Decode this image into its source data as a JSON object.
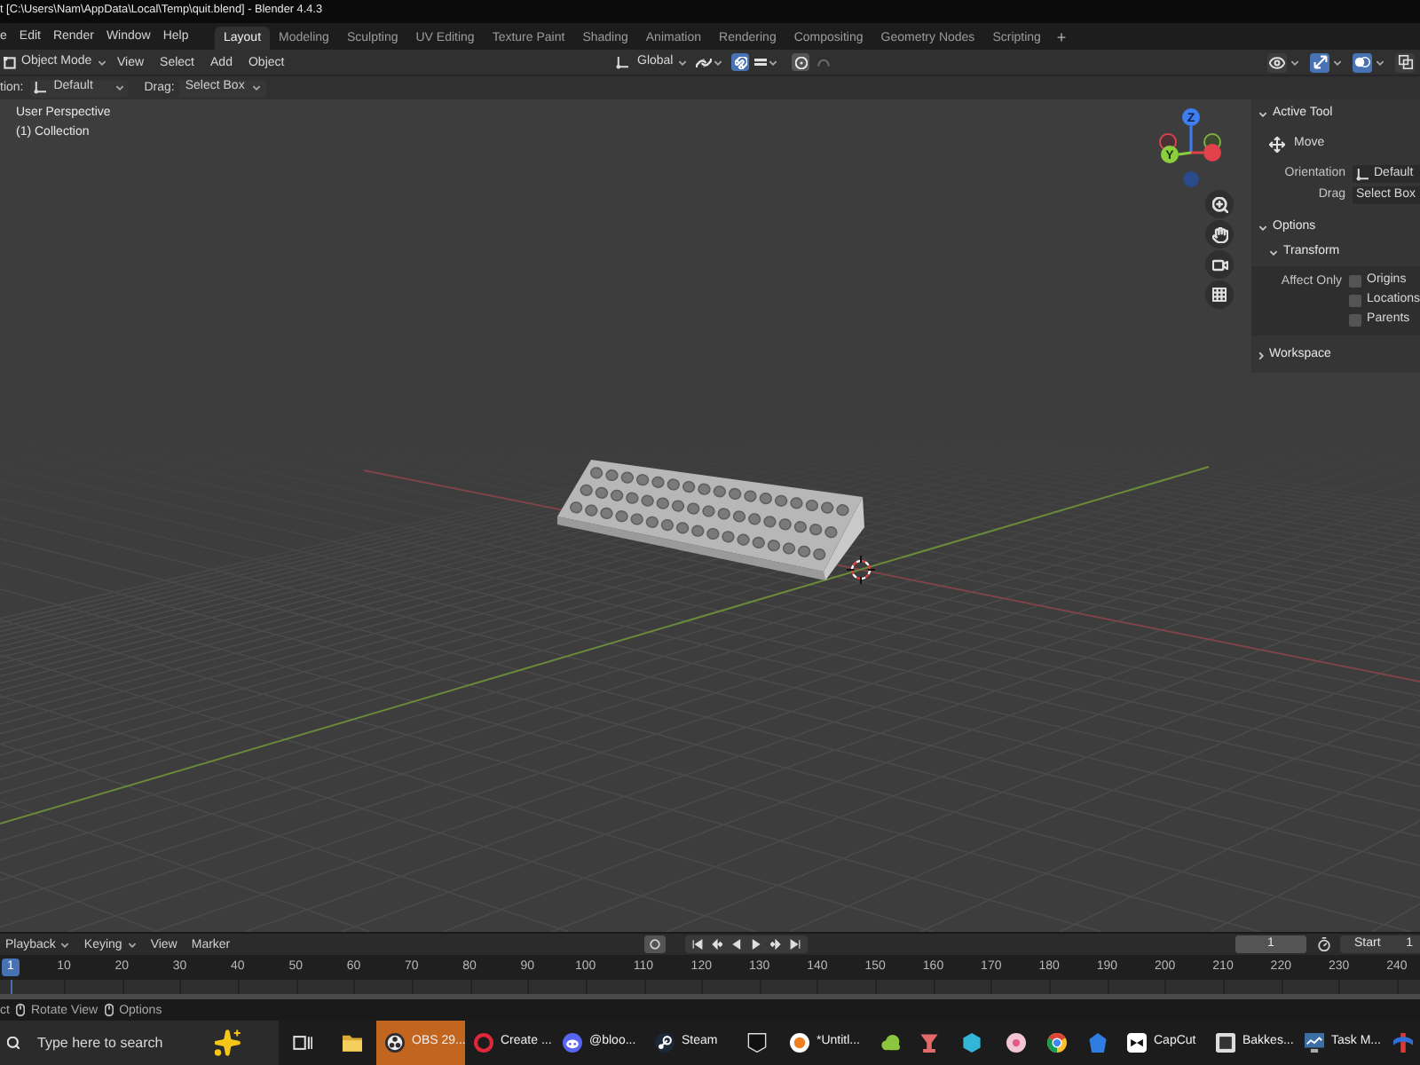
{
  "window": {
    "title": "t [C:\\Users\\Nam\\AppData\\Local\\Temp\\quit.blend] - Blender 4.4.3"
  },
  "menu_bar": {
    "menus": [
      "e",
      "Edit",
      "Render",
      "Window",
      "Help"
    ],
    "workspaces": [
      {
        "label": "Layout",
        "selected": true
      },
      {
        "label": "Modeling",
        "selected": false
      },
      {
        "label": "Sculpting",
        "selected": false
      },
      {
        "label": "UV Editing",
        "selected": false
      },
      {
        "label": "Texture Paint",
        "selected": false
      },
      {
        "label": "Shading",
        "selected": false
      },
      {
        "label": "Animation",
        "selected": false
      },
      {
        "label": "Rendering",
        "selected": false
      },
      {
        "label": "Compositing",
        "selected": false
      },
      {
        "label": "Geometry Nodes",
        "selected": false
      },
      {
        "label": "Scripting",
        "selected": false
      }
    ],
    "add_workspace": "+"
  },
  "viewport_header": {
    "mode": "Object Mode",
    "menus": [
      "View",
      "Select",
      "Add",
      "Object"
    ],
    "orientation": "Global",
    "snap": {
      "on": true
    },
    "proportional_editing": {
      "on": false
    },
    "display_toggles": [
      {
        "kind": "visibility",
        "on": false
      },
      {
        "kind": "gizmos",
        "on": true
      },
      {
        "kind": "overlays",
        "on": true
      },
      {
        "kind": "xray",
        "on": false
      }
    ]
  },
  "tool_settings": {
    "orientation_label": "tion:",
    "orientation": "Default",
    "drag_label": "Drag:",
    "drag": "Select Box"
  },
  "viewport": {
    "view_name": "User Perspective",
    "collection": "(1) Collection",
    "gizmo": {
      "z_label": "Z",
      "y_label": "Y"
    }
  },
  "sidebar": {
    "active_tool": {
      "title": "Active Tool",
      "expanded": true,
      "tool": "Move",
      "orientation_label": "Orientation",
      "orientation": "Default",
      "drag_label": "Drag",
      "drag": "Select Box"
    },
    "options": {
      "title": "Options",
      "expanded": true,
      "transform": {
        "title": "Transform",
        "expanded": true,
        "affect_label": "Affect Only",
        "checks": [
          {
            "label": "Origins",
            "checked": false
          },
          {
            "label": "Locations",
            "checked": false
          },
          {
            "label": "Parents",
            "checked": false
          }
        ]
      }
    },
    "workspace": {
      "title": "Workspace",
      "expanded": false
    }
  },
  "timeline": {
    "menus": [
      {
        "label": "Playback",
        "dropdown": true
      },
      {
        "label": "Keying",
        "dropdown": true
      },
      {
        "label": "View",
        "dropdown": false
      },
      {
        "label": "Marker",
        "dropdown": false
      }
    ],
    "current_frame": "1",
    "start_label": "Start",
    "start": "1",
    "frames": [
      {
        "label": "1",
        "selected": true
      },
      {
        "label": "10",
        "selected": false
      },
      {
        "label": "20",
        "selected": false
      },
      {
        "label": "30",
        "selected": false
      },
      {
        "label": "40",
        "selected": false
      },
      {
        "label": "50",
        "selected": false
      },
      {
        "label": "60",
        "selected": false
      },
      {
        "label": "70",
        "selected": false
      },
      {
        "label": "80",
        "selected": false
      },
      {
        "label": "90",
        "selected": false
      },
      {
        "label": "100",
        "selected": false
      },
      {
        "label": "110",
        "selected": false
      },
      {
        "label": "120",
        "selected": false
      },
      {
        "label": "130",
        "selected": false
      },
      {
        "label": "140",
        "selected": false
      },
      {
        "label": "150",
        "selected": false
      },
      {
        "label": "160",
        "selected": false
      },
      {
        "label": "170",
        "selected": false
      },
      {
        "label": "180",
        "selected": false
      },
      {
        "label": "190",
        "selected": false
      },
      {
        "label": "200",
        "selected": false
      },
      {
        "label": "210",
        "selected": false
      },
      {
        "label": "220",
        "selected": false
      },
      {
        "label": "230",
        "selected": false
      },
      {
        "label": "240",
        "selected": false
      }
    ]
  },
  "status_bar": [
    {
      "kind": "text",
      "label": "ct"
    },
    {
      "kind": "mouse",
      "label": "Rotate View"
    },
    {
      "kind": "mouse",
      "label": "Options"
    }
  ],
  "taskbar": {
    "search": {
      "placeholder": "Type here to search"
    },
    "apps": [
      {
        "kind": "taskview",
        "active": false
      },
      {
        "kind": "folder",
        "active": false
      },
      {
        "kind": "obs",
        "label": "OBS 29...",
        "active": true
      },
      {
        "kind": "ring",
        "label": "Create ...",
        "active": false
      },
      {
        "kind": "chat",
        "label": "@bloo...",
        "active": false
      },
      {
        "kind": "steam",
        "label": "Steam",
        "active": false
      },
      {
        "kind": "shield",
        "active": false
      },
      {
        "kind": "swirl",
        "label": "*Untitl...",
        "active": false
      },
      {
        "kind": "cloud",
        "active": false
      },
      {
        "kind": "cup",
        "active": false
      },
      {
        "kind": "hexagon",
        "active": false
      },
      {
        "kind": "flower",
        "active": false
      },
      {
        "kind": "wheel",
        "active": false
      },
      {
        "kind": "badge",
        "active": false
      },
      {
        "kind": "bow",
        "label": "CapCut",
        "active": false
      },
      {
        "kind": "tile",
        "label": "Bakkes...",
        "active": false
      },
      {
        "kind": "monitor",
        "label": "Task M...",
        "active": false
      },
      {
        "kind": "ribbon",
        "active": false
      }
    ]
  }
}
